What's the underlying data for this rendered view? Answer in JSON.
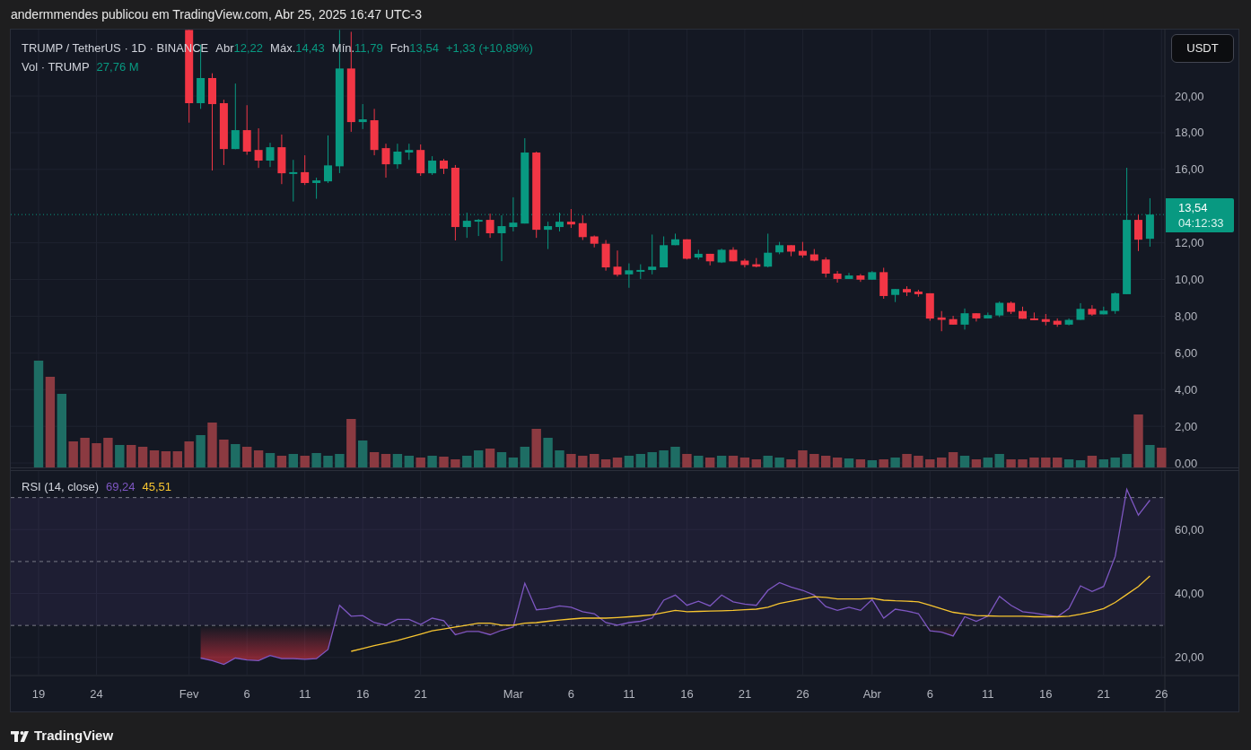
{
  "attribution": "andermmendes publicou em TradingView.com, Abr 25, 2025 16:47 UTC-3",
  "legend": {
    "symbol": "TRUMP / TetherUS · 1D · BINANCE",
    "open_label": "Abr",
    "open": "12,22",
    "high_label": "Máx.",
    "high": "14,43",
    "low_label": "Mín.",
    "low": "11,79",
    "close_label": "Fch",
    "close": "13,54",
    "change": "+1,33 (+10,89%)"
  },
  "volume_legend": {
    "label": "Vol · TRUMP",
    "value": "27,76 M"
  },
  "currency_button": "USDT",
  "price_chart": {
    "chart_data": {
      "type": "candlestick",
      "ylim": [
        -0.29,
        23.62
      ],
      "yticks": [
        {
          "value": 0,
          "label": "0,00"
        },
        {
          "value": 2,
          "label": "2,00"
        },
        {
          "value": 4,
          "label": "4,00"
        },
        {
          "value": 6,
          "label": "6,00"
        },
        {
          "value": 8,
          "label": "8,00"
        },
        {
          "value": 10,
          "label": "10,00"
        },
        {
          "value": 12,
          "label": "12,00"
        },
        {
          "value": 16,
          "label": "16,00"
        },
        {
          "value": 18,
          "label": "18,00"
        },
        {
          "value": 20,
          "label": "20,00"
        }
      ],
      "categories": [
        null,
        null,
        null,
        null,
        null,
        null,
        null,
        null,
        null,
        null,
        null,
        null,
        null,
        null,
        null,
        null,
        null,
        null,
        null,
        null,
        null,
        null,
        null,
        null,
        null,
        null,
        null,
        null,
        null,
        null,
        null,
        null,
        null,
        null,
        null,
        null,
        null,
        null,
        null,
        null,
        null,
        null,
        null,
        null,
        null,
        null,
        null,
        null,
        null,
        null,
        null,
        null,
        null,
        null,
        null,
        null,
        null,
        null,
        null,
        null,
        null,
        null,
        null,
        null,
        null,
        null,
        null,
        null,
        null,
        null,
        null,
        null,
        null,
        null,
        null,
        null,
        null,
        null,
        null,
        null,
        null,
        null,
        null,
        null
      ],
      "ohlc": [
        [
          23.6,
          23.6,
          18.55,
          19.61
        ],
        [
          19.61,
          22.8,
          19.3,
          20.98
        ],
        [
          20.98,
          21.24,
          15.94,
          19.56
        ],
        [
          19.61,
          19.8,
          16.24,
          17.11
        ],
        [
          17.11,
          20.68,
          17.1,
          18.14
        ],
        [
          18.14,
          19.5,
          16.8,
          16.97
        ],
        [
          17.06,
          18.24,
          16.08,
          16.48
        ],
        [
          16.48,
          17.45,
          16.13,
          17.21
        ],
        [
          17.21,
          17.9,
          15.2,
          15.79
        ],
        [
          15.8,
          16.52,
          14.25,
          15.85
        ],
        [
          15.85,
          16.77,
          15.15,
          15.26
        ],
        [
          15.26,
          15.55,
          14.4,
          15.4
        ],
        [
          15.35,
          17.85,
          15.26,
          16.22
        ],
        [
          16.17,
          23.6,
          15.8,
          21.5
        ],
        [
          21.5,
          23.5,
          18.05,
          18.58
        ],
        [
          18.58,
          19.56,
          18.2,
          18.73
        ],
        [
          18.68,
          19.3,
          16.77,
          17.06
        ],
        [
          17.16,
          17.4,
          15.55,
          16.28
        ],
        [
          16.28,
          17.4,
          16.04,
          16.97
        ],
        [
          16.92,
          17.4,
          16.52,
          17.06
        ],
        [
          17.06,
          17.36,
          15.65,
          15.79
        ],
        [
          15.79,
          16.72,
          15.7,
          16.48
        ],
        [
          16.48,
          16.57,
          15.75,
          16.04
        ],
        [
          16.09,
          16.24,
          12.13,
          12.86
        ],
        [
          12.86,
          13.64,
          12.27,
          13.2
        ],
        [
          13.2,
          13.3,
          12.37,
          13.25
        ],
        [
          13.25,
          13.59,
          12.27,
          12.52
        ],
        [
          12.52,
          13.5,
          11.0,
          12.91
        ],
        [
          12.86,
          14.48,
          12.62,
          13.1
        ],
        [
          13.05,
          17.7,
          13.05,
          16.92
        ],
        [
          16.92,
          16.97,
          12.27,
          12.71
        ],
        [
          12.71,
          13.15,
          11.66,
          12.91
        ],
        [
          12.86,
          13.64,
          12.62,
          13.15
        ],
        [
          13.15,
          13.84,
          12.81,
          13.0
        ],
        [
          13.07,
          13.5,
          12.15,
          12.31
        ],
        [
          12.35,
          12.4,
          11.75,
          11.95
        ],
        [
          11.95,
          12.15,
          10.48,
          10.66
        ],
        [
          10.7,
          11.58,
          10.16,
          10.26
        ],
        [
          10.28,
          10.88,
          9.55,
          10.5
        ],
        [
          10.5,
          10.83,
          10.03,
          10.52
        ],
        [
          10.52,
          12.45,
          10.28,
          10.7
        ],
        [
          10.66,
          12.35,
          10.66,
          11.87
        ],
        [
          11.87,
          12.5,
          11.87,
          12.19
        ],
        [
          12.19,
          12.19,
          11.09,
          11.13
        ],
        [
          11.2,
          11.62,
          11.09,
          11.4
        ],
        [
          11.4,
          11.4,
          10.77,
          10.99
        ],
        [
          10.93,
          11.68,
          10.9,
          11.62
        ],
        [
          11.62,
          11.76,
          10.99,
          10.99
        ],
        [
          11.03,
          11.13,
          10.66,
          10.79
        ],
        [
          10.83,
          11.17,
          10.66,
          10.7
        ],
        [
          10.7,
          12.5,
          10.66,
          11.46
        ],
        [
          11.48,
          12.05,
          11.38,
          11.87
        ],
        [
          11.87,
          11.87,
          11.27,
          11.52
        ],
        [
          11.56,
          12.05,
          11.19,
          11.31
        ],
        [
          11.37,
          11.66,
          10.99,
          11.03
        ],
        [
          11.09,
          11.21,
          10.11,
          10.32
        ],
        [
          10.32,
          10.46,
          9.83,
          10.03
        ],
        [
          10.03,
          10.36,
          10.03,
          10.22
        ],
        [
          10.22,
          10.3,
          9.87,
          9.99
        ],
        [
          9.99,
          10.46,
          9.99,
          10.4
        ],
        [
          10.4,
          10.64,
          8.95,
          9.1
        ],
        [
          9.16,
          9.48,
          8.77,
          9.48
        ],
        [
          9.48,
          9.63,
          9.1,
          9.3
        ],
        [
          9.34,
          9.44,
          9.06,
          9.2
        ],
        [
          9.25,
          9.25,
          7.75,
          7.87
        ],
        [
          7.93,
          8.28,
          7.18,
          7.8
        ],
        [
          7.84,
          8.02,
          7.54,
          7.54
        ],
        [
          7.54,
          8.42,
          7.27,
          8.16
        ],
        [
          8.16,
          8.16,
          7.71,
          7.88
        ],
        [
          7.88,
          8.2,
          7.88,
          8.06
        ],
        [
          8.04,
          8.8,
          7.95,
          8.73
        ],
        [
          8.73,
          8.8,
          8.12,
          8.24
        ],
        [
          8.28,
          8.52,
          7.86,
          7.86
        ],
        [
          7.88,
          8.2,
          7.8,
          7.8
        ],
        [
          7.84,
          8.12,
          7.5,
          7.69
        ],
        [
          7.75,
          7.88,
          7.42,
          7.54
        ],
        [
          7.54,
          7.88,
          7.5,
          7.8
        ],
        [
          7.8,
          8.71,
          7.8,
          8.4
        ],
        [
          8.4,
          8.6,
          8.02,
          8.09
        ],
        [
          8.1,
          8.52,
          8.1,
          8.3
        ],
        [
          8.28,
          9.3,
          8.13,
          9.25
        ],
        [
          9.2,
          16.09,
          9.2,
          13.25
        ],
        [
          13.25,
          13.54,
          11.55,
          12.17
        ],
        [
          12.22,
          14.43,
          11.79,
          13.54
        ]
      ]
    }
  },
  "last_price": {
    "price": "13,54",
    "countdown": "04:12:33"
  },
  "rsi": {
    "label": "RSI (14, close)",
    "rsi_value": "69,24",
    "ma_value": "45,51",
    "chart_data": {
      "type": "line",
      "ylim": [
        3.1,
        78.6
      ],
      "yticks": [
        {
          "value": 20,
          "label": "20,00"
        },
        {
          "value": 40,
          "label": "40,00"
        },
        {
          "value": 60,
          "label": "60,00"
        }
      ],
      "categories": [
        "19",
        null,
        null,
        null,
        null,
        "24",
        null,
        null,
        null,
        null,
        null,
        null,
        null,
        "Fev",
        null,
        null,
        null,
        null,
        "6",
        null,
        null,
        null,
        null,
        "11",
        null,
        null,
        null,
        null,
        "16",
        null,
        null,
        null,
        null,
        "21",
        null,
        null,
        null,
        null,
        null,
        null,
        null,
        "Mar",
        null,
        null,
        null,
        null,
        "6",
        null,
        null,
        null,
        null,
        "11",
        null,
        null,
        null,
        null,
        "16",
        null,
        null,
        null,
        null,
        "21",
        null,
        null,
        null,
        null,
        "26",
        null,
        null,
        null,
        null,
        null,
        "Abr",
        null,
        null,
        null,
        null,
        "6",
        null,
        null,
        null,
        null,
        "11",
        null,
        null,
        null,
        null,
        "16",
        null,
        null,
        null,
        null,
        "21",
        null,
        null,
        null,
        null,
        "26"
      ],
      "series": [
        {
          "color": "#7e57c2",
          "values": [
            null,
            null,
            null,
            null,
            null,
            null,
            null,
            null,
            null,
            null,
            null,
            null,
            null,
            null,
            19.8,
            19.0,
            17.8,
            19.8,
            19.2,
            19.0,
            20.6,
            19.6,
            19.6,
            19.4,
            19.6,
            22.5,
            36.3,
            32.9,
            33.1,
            30.9,
            30.1,
            31.9,
            31.9,
            30.3,
            32.3,
            31.5,
            27.1,
            28.1,
            28.1,
            27.1,
            28.5,
            29.5,
            43.2,
            34.9,
            35.3,
            36.1,
            35.7,
            34.3,
            33.7,
            30.9,
            30.1,
            30.9,
            31.3,
            32.3,
            37.9,
            39.5,
            36.3,
            37.6,
            36.1,
            39.5,
            37.4,
            36.7,
            36.3,
            41.0,
            43.4,
            42.0,
            41.0,
            39.5,
            35.9,
            34.7,
            35.7,
            34.7,
            38.1,
            32.3,
            35.1,
            34.5,
            33.7,
            28.3,
            27.9,
            26.7,
            32.7,
            31.3,
            32.9,
            39.1,
            36.3,
            34.3,
            33.9,
            33.3,
            32.7,
            35.3,
            42.4,
            40.6,
            42.2,
            51.6,
            72.6,
            64.5,
            69.2,
            null
          ]
        },
        {
          "color": "#f7c530",
          "values": [
            null,
            null,
            null,
            null,
            null,
            null,
            null,
            null,
            null,
            null,
            null,
            null,
            null,
            null,
            null,
            null,
            null,
            null,
            null,
            null,
            null,
            null,
            null,
            null,
            null,
            null,
            null,
            21.9,
            22.8,
            23.7,
            24.5,
            25.3,
            26.3,
            27.3,
            28.3,
            28.9,
            29.5,
            30.1,
            30.7,
            30.7,
            30.1,
            30.1,
            30.7,
            30.9,
            31.3,
            31.7,
            32.0,
            32.3,
            32.3,
            32.3,
            32.5,
            32.7,
            33.0,
            33.3,
            34.0,
            34.7,
            34.3,
            34.4,
            34.5,
            34.6,
            34.7,
            34.9,
            35.1,
            35.7,
            36.9,
            37.6,
            38.3,
            39.0,
            38.8,
            38.3,
            38.3,
            38.3,
            38.5,
            37.9,
            37.7,
            37.6,
            37.4,
            36.3,
            35.2,
            34.1,
            33.6,
            33.1,
            33.0,
            32.9,
            32.9,
            32.9,
            32.7,
            32.7,
            32.7,
            32.9,
            33.5,
            34.3,
            35.3,
            37.2,
            39.7,
            42.2,
            45.5,
            null
          ]
        }
      ]
    }
  },
  "brand": "TradingView"
}
